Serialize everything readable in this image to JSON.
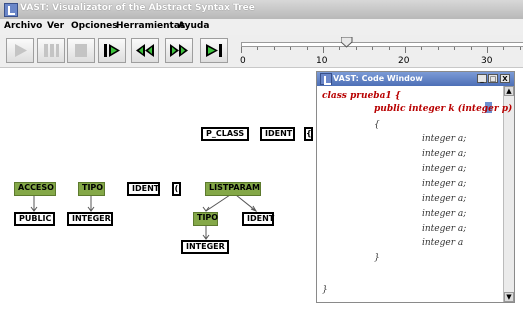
{
  "window": {
    "title": "VAST: Visualizator of the Abstract Syntax Tree"
  },
  "menu": [
    "Archivo",
    "Ver",
    "Opciones",
    "Herramientas",
    "Ayuda"
  ],
  "toolbar": {
    "buttons": [
      "play-disabled",
      "pause-disabled",
      "stop-disabled",
      "step-forward",
      "rewind",
      "fast-forward",
      "skip-to-end"
    ]
  },
  "slider": {
    "ticks": [
      "0",
      "10",
      "20",
      "30"
    ],
    "value": 13
  },
  "tree": {
    "nodes": [
      "P_CLASS",
      "IDENT",
      "{",
      "ACCESO",
      "TIPO",
      "IDENT",
      "(",
      "LISTPARAM",
      "PUBLIC",
      "INTEGER",
      "TIPO",
      "IDENT",
      "INTEGER"
    ]
  },
  "code_window": {
    "title": "VAST: Code Window",
    "buttons": [
      "_",
      "□",
      "X"
    ],
    "lines": [
      "class prueba1 {",
      "public integer k (integer p)",
      "{",
      "integer a;",
      "integer a;",
      "integer a;",
      "integer a;",
      "integer a;",
      "integer a;",
      "integer a;",
      "integer a",
      "}",
      "}"
    ]
  }
}
